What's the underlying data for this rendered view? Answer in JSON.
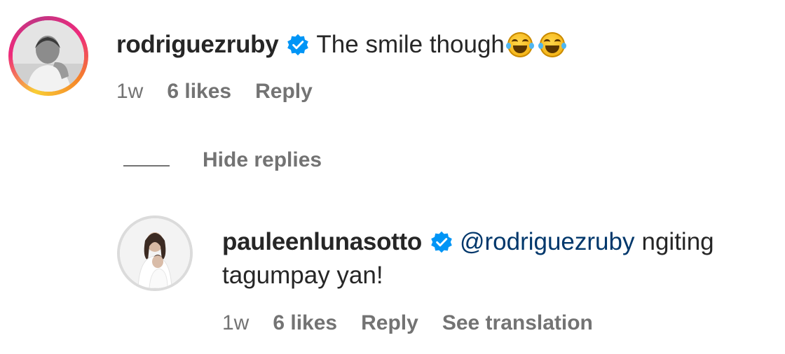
{
  "comment": {
    "username": "rodriguezruby",
    "verified_icon": "verified-badge-icon",
    "text": "The smile though",
    "emojis": [
      "face-with-tears-of-joy",
      "face-with-tears-of-joy"
    ],
    "time": "1w",
    "likes": "6 likes",
    "reply_label": "Reply"
  },
  "replies_toggle": {
    "label": "Hide replies"
  },
  "reply": {
    "username": "pauleenlunasotto",
    "verified_icon": "verified-badge-icon",
    "mention": "@rodriguezruby",
    "text_line1": "ngiting",
    "text_line2": "tagumpay yan!",
    "time": "1w",
    "likes": "6 likes",
    "reply_label": "Reply",
    "translation_label": "See translation"
  },
  "colors": {
    "verified_blue": "#0095f6",
    "mention": "#00376b",
    "meta_gray": "#737373"
  }
}
